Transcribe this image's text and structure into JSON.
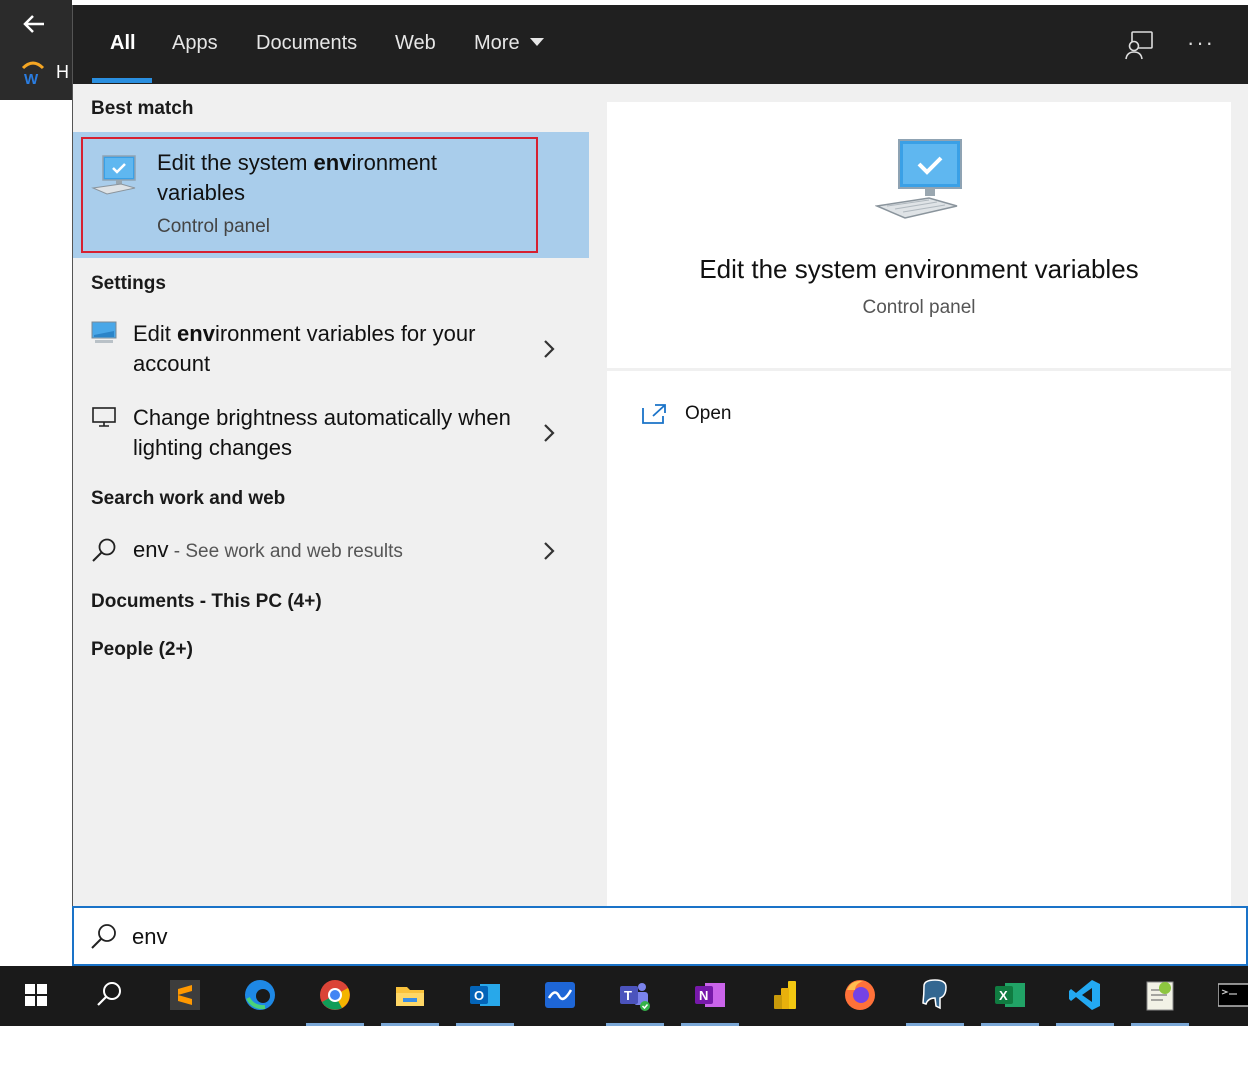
{
  "background_app": {
    "partial_label": "H"
  },
  "tabs": [
    {
      "label": "All",
      "active": true
    },
    {
      "label": "Apps",
      "active": false
    },
    {
      "label": "Documents",
      "active": false
    },
    {
      "label": "Web",
      "active": false
    },
    {
      "label": "More",
      "active": false
    }
  ],
  "topbar": {
    "more_options_label": "···"
  },
  "best_match": {
    "header": "Best match",
    "title_before": "Edit the system ",
    "title_bold": "env",
    "title_after": "ironment variables",
    "subtitle": "Control panel"
  },
  "settings": {
    "header": "Settings",
    "items": [
      {
        "title_before": "Edit ",
        "title_bold": "env",
        "title_after": "ironment variables for your account"
      },
      {
        "title_before": "Change brightness automatically when lighting changes",
        "title_bold": "",
        "title_after": ""
      }
    ]
  },
  "web": {
    "header": "Search work and web",
    "query": "env",
    "hint": " - See work and web results"
  },
  "documents": {
    "header": "Documents - This PC (4+)"
  },
  "people": {
    "header": "People (2+)"
  },
  "preview": {
    "title": "Edit the system environment variables",
    "subtitle": "Control panel",
    "open_label": "Open"
  },
  "search": {
    "value": "env"
  },
  "colors": {
    "accent": "#2a8fe0",
    "selected_bg": "#a9cdeb",
    "highlight_border": "#d62030"
  },
  "taskbar_icons": [
    "windows-start-icon",
    "search-icon",
    "sublime-text-icon",
    "edge-icon",
    "chrome-icon",
    "file-explorer-icon",
    "outlook-icon",
    "whiteboard-icon",
    "teams-icon",
    "onenote-icon",
    "power-bi-icon",
    "firefox-icon",
    "pgadmin-icon",
    "excel-icon",
    "vscode-icon",
    "notepad-plus-plus-icon",
    "command-prompt-icon"
  ]
}
